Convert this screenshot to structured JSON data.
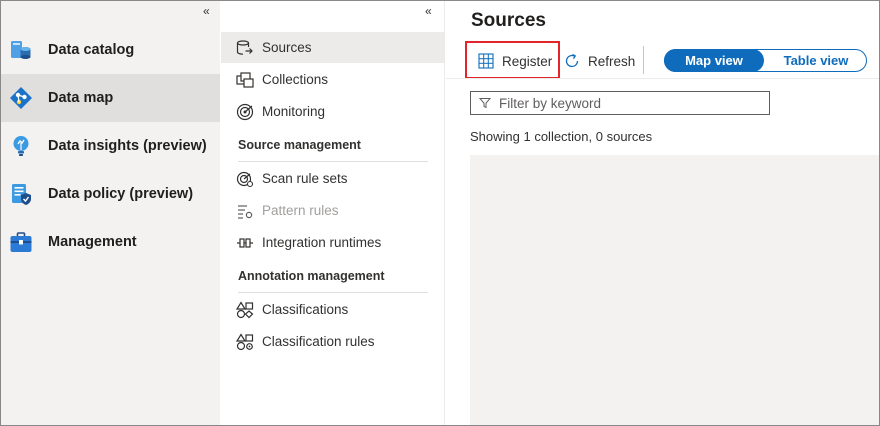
{
  "left_nav": {
    "collapse_icon": "double-chevron-left-icon",
    "items": [
      {
        "label": "Data catalog",
        "icon": "data-catalog-icon",
        "active": false
      },
      {
        "label": "Data map",
        "icon": "data-map-icon",
        "active": true
      },
      {
        "label": "Data insights (preview)",
        "icon": "data-insights-icon",
        "active": false
      },
      {
        "label": "Data policy (preview)",
        "icon": "data-policy-icon",
        "active": false
      },
      {
        "label": "Management",
        "icon": "management-icon",
        "active": false
      }
    ]
  },
  "mid_nav": {
    "collapse_icon": "double-chevron-left-icon",
    "items": [
      {
        "label": "Sources",
        "icon": "sources-icon",
        "active": true
      },
      {
        "label": "Collections",
        "icon": "collections-icon"
      },
      {
        "label": "Monitoring",
        "icon": "monitoring-icon"
      }
    ],
    "source_management": {
      "header": "Source management",
      "items": [
        {
          "label": "Scan rule sets",
          "icon": "scan-rule-sets-icon",
          "disabled": false
        },
        {
          "label": "Pattern rules",
          "icon": "pattern-rules-icon",
          "disabled": true
        },
        {
          "label": "Integration runtimes",
          "icon": "integration-runtimes-icon",
          "disabled": false
        }
      ]
    },
    "annotation_management": {
      "header": "Annotation management",
      "items": [
        {
          "label": "Classifications",
          "icon": "classifications-icon"
        },
        {
          "label": "Classification rules",
          "icon": "classification-rules-icon"
        }
      ]
    }
  },
  "main": {
    "title": "Sources",
    "toolbar": {
      "register_label": "Register",
      "register_icon": "grid-register-icon",
      "refresh_label": "Refresh",
      "refresh_icon": "refresh-icon",
      "view_toggle": {
        "map_label": "Map view",
        "table_label": "Table view",
        "selected": "Map view"
      }
    },
    "filter": {
      "placeholder": "Filter by keyword",
      "value": "",
      "icon": "filter-icon"
    },
    "status_text": "Showing 1 collection, 0 sources"
  },
  "colors": {
    "accent": "#0f6cbd",
    "highlight_box": "#e3242b",
    "left_nav_bg": "#f3f2f1",
    "active_item_bg": "#e1dfdd",
    "map_canvas_bg": "#f3f2f1"
  }
}
